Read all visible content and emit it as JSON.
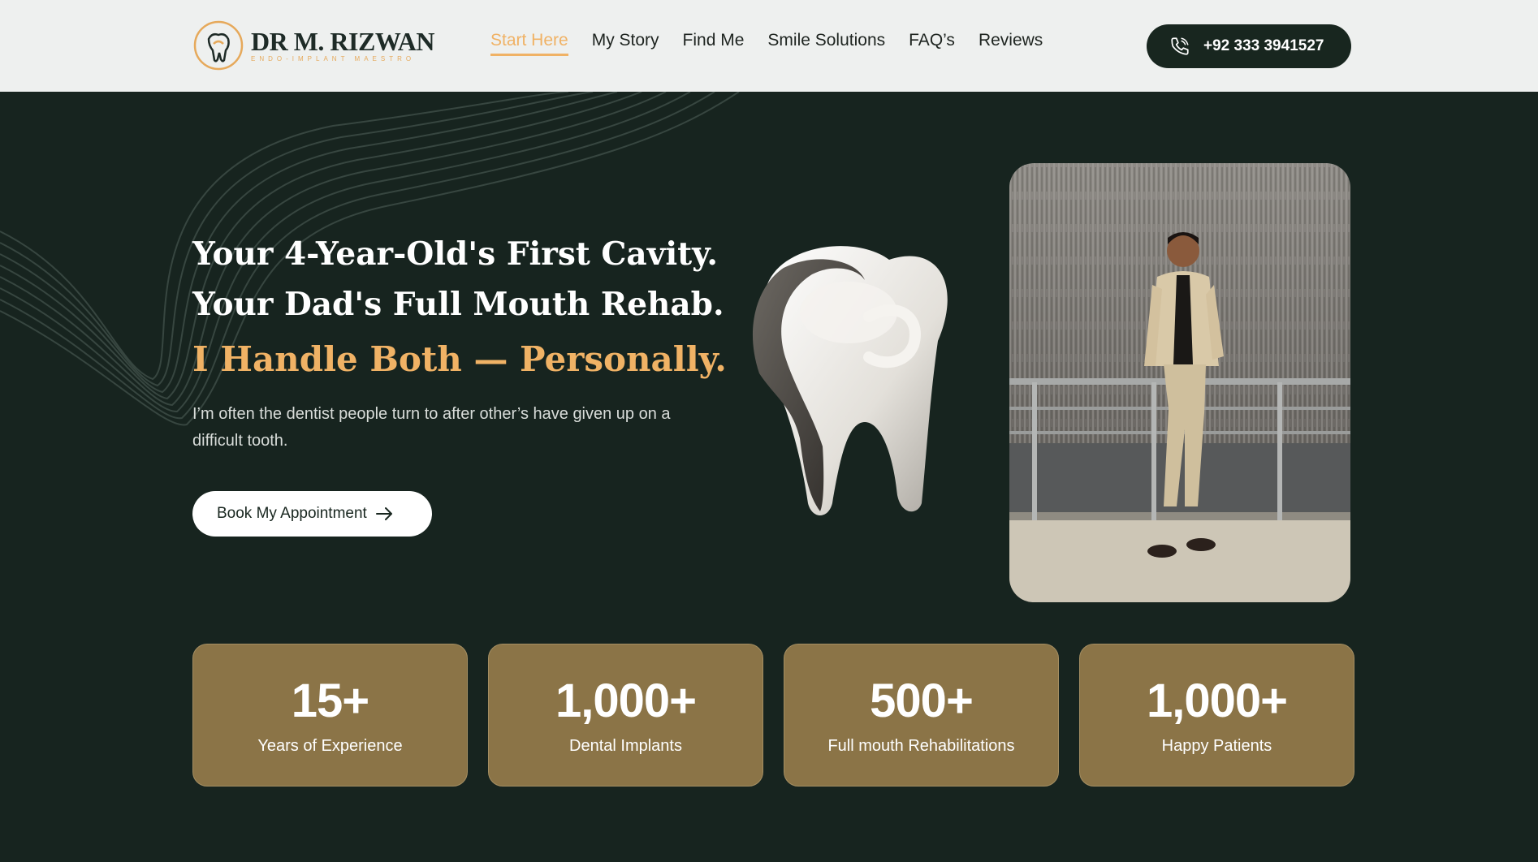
{
  "header": {
    "logo_name": "DR M. RIZWAN",
    "logo_tagline": "ENDO-IMPLANT MAESTRO",
    "nav": [
      {
        "label": "Start Here",
        "active": true
      },
      {
        "label": "My Story"
      },
      {
        "label": "Find Me"
      },
      {
        "label": "Smile Solutions"
      },
      {
        "label": "FAQ’s"
      },
      {
        "label": "Reviews"
      }
    ],
    "phone": "+92 333 3941527",
    "phone_icon": "phone-icon"
  },
  "hero": {
    "line1": "Your 4-Year-Old's First Cavity.",
    "line2": "Your Dad's Full Mouth Rehab.",
    "line3": "I Handle Both — Personally.",
    "subtext": "I’m often the dentist people turn to after other’s have given up on a difficult tooth.",
    "cta_label": "Book My Appointment"
  },
  "stats": [
    {
      "value": "15+",
      "label": "Years of Experience"
    },
    {
      "value": "1,000+",
      "label": "Dental Implants"
    },
    {
      "value": "500+",
      "label": "Full mouth Rehabilitations"
    },
    {
      "value": "1,000+",
      "label": "Happy Patients"
    }
  ],
  "colors": {
    "accent": "#f0b265",
    "dark_bg": "#17241f",
    "card": "#8b7447",
    "topbar": "#eef0ef"
  }
}
